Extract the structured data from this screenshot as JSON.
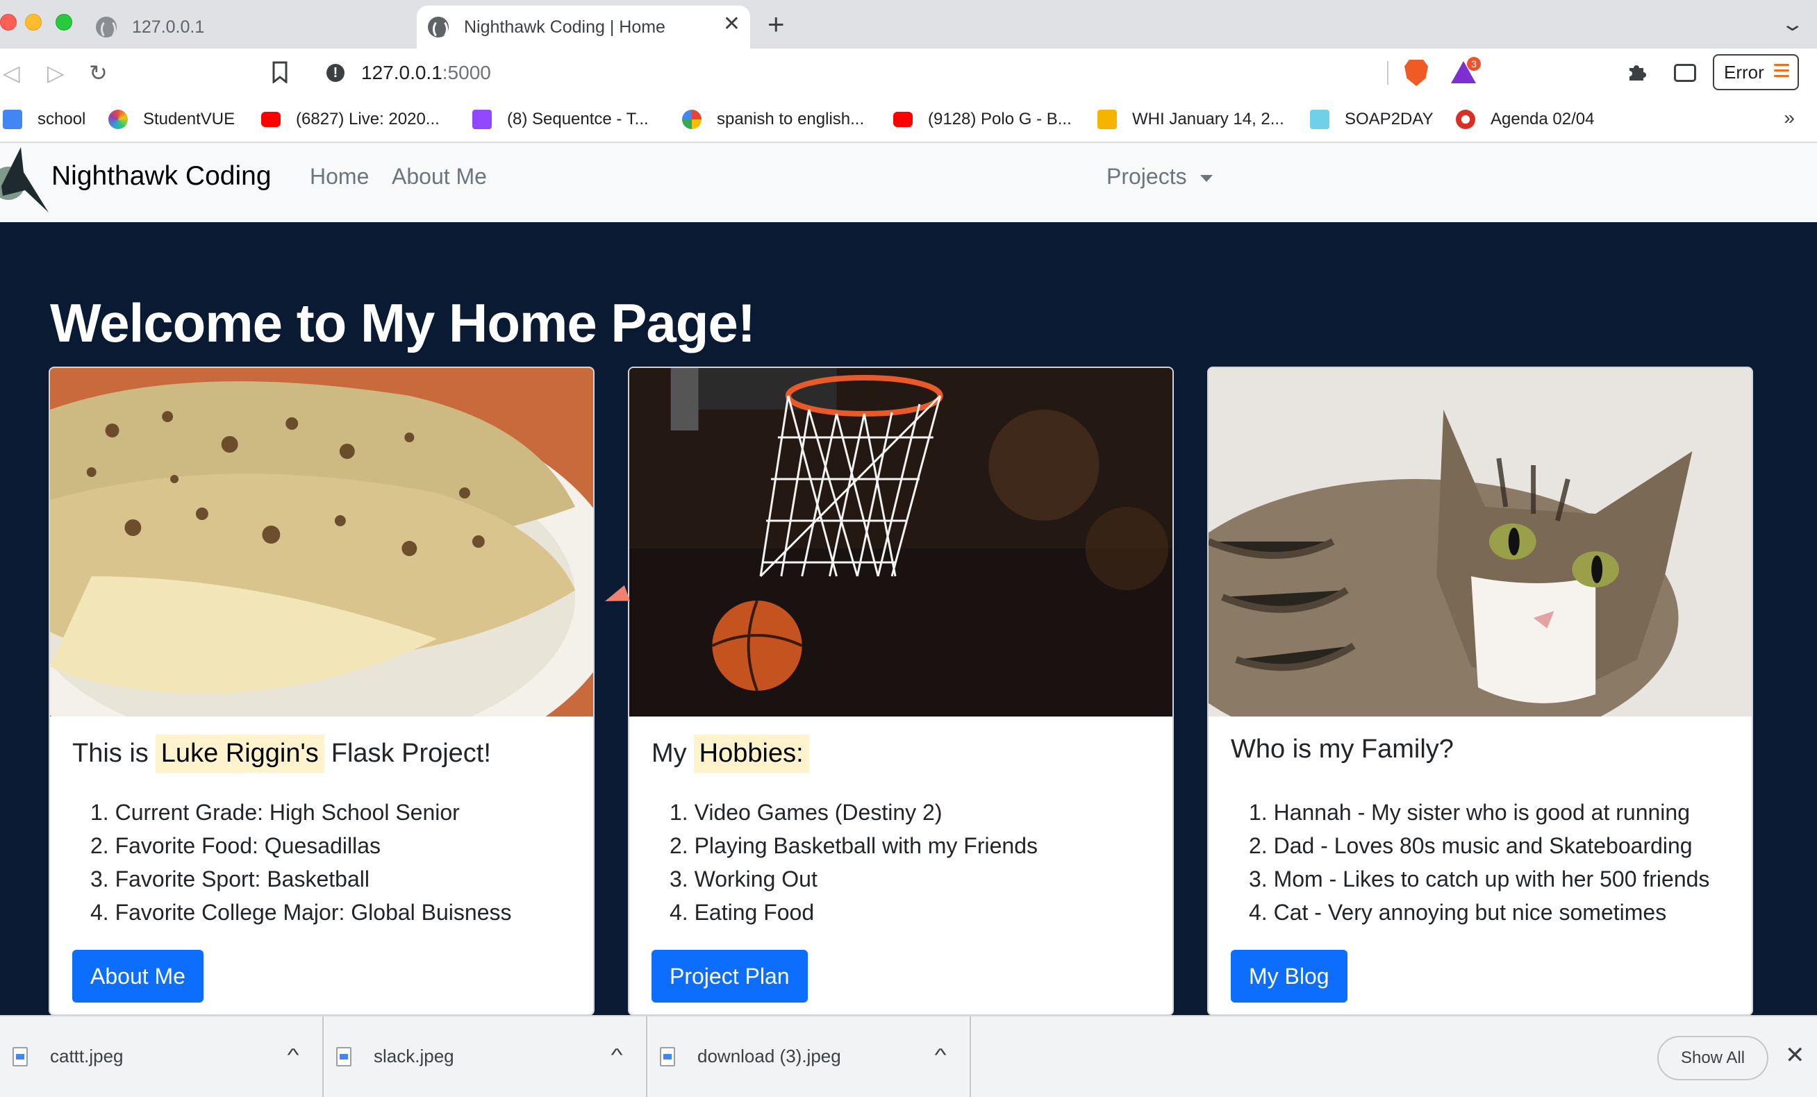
{
  "browser": {
    "tabs": [
      {
        "title": "127.0.0.1",
        "active": false
      },
      {
        "title": "Nighthawk Coding | Home",
        "active": true
      }
    ],
    "tab_close": "✕",
    "new_tab": "+",
    "tab_overflow": "⌄",
    "url_host": "127.0.0.1",
    "url_port": ":5000",
    "info_glyph": "!",
    "bat_badge": "3",
    "error_label": "Error",
    "bookmarks": [
      {
        "label": "school",
        "icon": "google-docs-icon",
        "color": "#4285f4"
      },
      {
        "label": "StudentVUE",
        "icon": "studentvue-icon",
        "color": "#8e44ad"
      },
      {
        "label": "(6827) Live: 2020...",
        "icon": "youtube-icon",
        "color": "#ff0000"
      },
      {
        "label": "(8) Sequentce - T...",
        "icon": "twitch-icon",
        "color": "#9146ff"
      },
      {
        "label": "spanish to english...",
        "icon": "google-icon",
        "color": "#4285f4"
      },
      {
        "label": "(9128) Polo G - B...",
        "icon": "youtube-icon",
        "color": "#ff0000"
      },
      {
        "label": "WHI January 14, 2...",
        "icon": "google-slides-icon",
        "color": "#f4b400"
      },
      {
        "label": "SOAP2DAY",
        "icon": "soap2day-icon",
        "color": "#6fd0e8"
      },
      {
        "label": "Agenda 02/04",
        "icon": "agenda-icon",
        "color": "#d93025"
      }
    ],
    "bookmarks_more": "»"
  },
  "site": {
    "brand": "Nighthawk Coding",
    "nav": {
      "home": "Home",
      "about": "About Me",
      "projects": "Projects"
    },
    "page_title": "Welcome to My Home Page!",
    "cards": [
      {
        "image": "quesadilla-photo",
        "title_before": "This is",
        "title_highlight": "Luke Riggin's",
        "title_after": "Flask Project!",
        "items": [
          "1. Current Grade: High School Senior",
          "2. Favorite Food: Quesadillas",
          "3. Favorite Sport: Basketball",
          "4. Favorite College Major: Global Buisness"
        ],
        "button": "About Me"
      },
      {
        "image": "basketball-hoop-photo",
        "title_before": "My",
        "title_highlight": "Hobbies:",
        "title_after": "",
        "items": [
          "1. Video Games (Destiny 2)",
          "2. Playing Basketball with my Friends",
          "3. Working Out",
          "4. Eating Food"
        ],
        "button": "Project Plan"
      },
      {
        "image": "cat-photo",
        "title_before": "Who is my Family?",
        "title_highlight": "",
        "title_after": "",
        "items": [
          "1. Hannah - My sister who is good at running",
          "2. Dad - Loves 80s music and Skateboarding",
          "3. Mom - Likes to catch up with her 500 friends",
          "4. Cat - Very annoying but nice sometimes"
        ],
        "button": "My Blog"
      }
    ]
  },
  "downloads": {
    "items": [
      "cattt.jpeg",
      "slack.jpeg",
      "download (3).jpeg"
    ],
    "chevron": "^",
    "show_all": "Show All",
    "close": "✕"
  }
}
